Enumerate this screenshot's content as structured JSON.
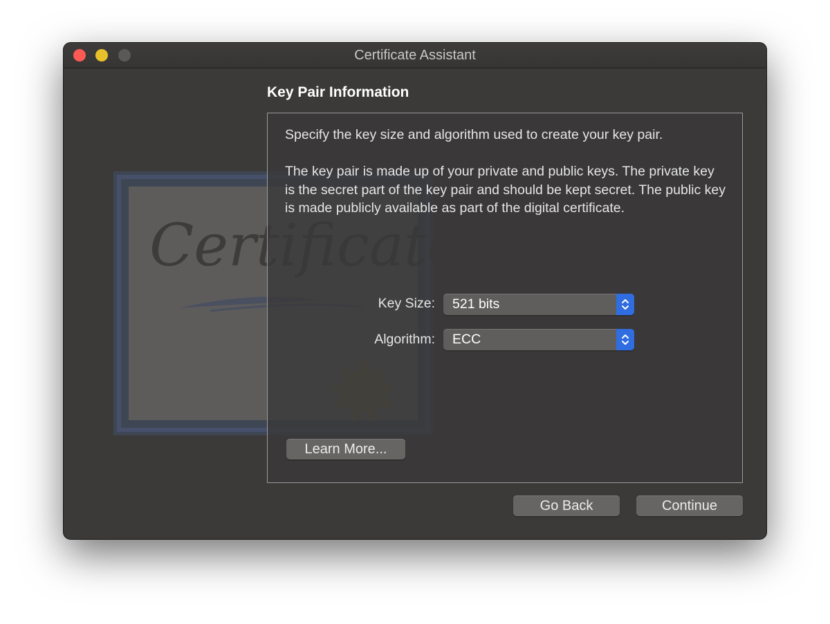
{
  "window": {
    "title": "Certificate Assistant"
  },
  "background_art": {
    "icon": "certificate-icon",
    "text": "Certificate"
  },
  "page": {
    "heading": "Key Pair Information",
    "intro": "Specify the key size and algorithm used to create your key pair.",
    "description": "The key pair is made up of your private and public keys. The private key is the secret part of the key pair and should be kept secret. The public key is made publicly available as part of the digital certificate."
  },
  "fields": {
    "key_size": {
      "label": "Key Size:",
      "value": "521 bits"
    },
    "algorithm": {
      "label": "Algorithm:",
      "value": "ECC"
    }
  },
  "buttons": {
    "learn_more": "Learn More...",
    "go_back": "Go Back",
    "continue": "Continue"
  },
  "colors": {
    "window_bg": "#3b3a39",
    "accent": "#2f6de1",
    "close": "#fd5a53",
    "minimize": "#e7c02b",
    "zoom_disabled": "#5a5958"
  }
}
